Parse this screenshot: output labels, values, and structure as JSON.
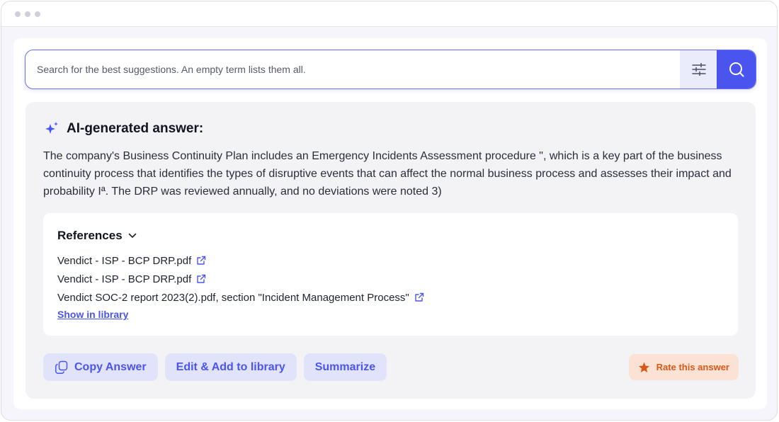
{
  "search": {
    "placeholder": "Search for the best suggestions. An empty term lists them all.",
    "filter_icon": "sliders-icon",
    "search_icon": "search-icon"
  },
  "answer": {
    "icon": "sparkle-icon",
    "title": "AI-generated answer:",
    "text": "The company's Business Continuity Plan includes an Emergency Incidents Assessment procedure \", which is a key part of the business continuity process that identifies the types of disruptive events that can affect the normal business process and assesses their impact and probability Iª. The DRP was reviewed annually, and no deviations were noted 3)"
  },
  "references": {
    "title": "References",
    "items": [
      {
        "label": "Vendict - ISP - BCP DRP.pdf"
      },
      {
        "label": "Vendict - ISP - BCP DRP.pdf"
      },
      {
        "label": "Vendict SOC-2 report 2023(2).pdf, section \"Incident Management Process\""
      }
    ],
    "show_in_library": "Show in library"
  },
  "actions": {
    "copy_answer": "Copy Answer",
    "edit_add": "Edit & Add to library",
    "summarize": "Summarize",
    "rate": "Rate this answer"
  },
  "colors": {
    "accent": "#4a55f0",
    "accent_soft": "#e1e3fb",
    "rate_bg": "#fbe2d4",
    "rate_fg": "#d8581a",
    "card_bg": "#f3f3f6"
  }
}
